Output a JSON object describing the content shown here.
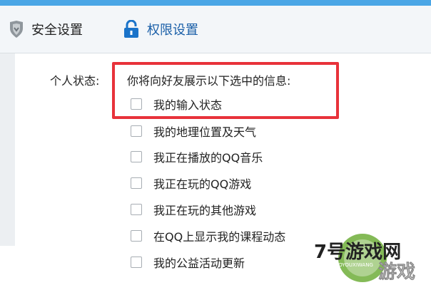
{
  "tabs": [
    {
      "label": "安全设置",
      "icon": "shield-icon",
      "active": false
    },
    {
      "label": "权限设置",
      "icon": "lock-icon",
      "active": true
    }
  ],
  "status_section": {
    "label": "个人状态:",
    "intro": "你将向好友展示以下选中的信息:",
    "options": [
      {
        "label": "我的输入状态",
        "checked": false
      },
      {
        "label": "我的地理位置及天气",
        "checked": false
      },
      {
        "label": "我正在播放的QQ音乐",
        "checked": false
      },
      {
        "label": "我正在玩的QQ游戏",
        "checked": false
      },
      {
        "label": "我正在玩的其他游戏",
        "checked": false
      },
      {
        "label": "在QQ上显示我的课程动态",
        "checked": false
      },
      {
        "label": "我的公益活动更新",
        "checked": false
      }
    ]
  },
  "watermark": {
    "text": "7号游戏网",
    "sub": "7HAOYOUXIWANG",
    "sub2": "游戏"
  },
  "colors": {
    "accent": "#4aa6e6",
    "highlight": "#e8323a",
    "active_tab": "#1a5fa8"
  }
}
